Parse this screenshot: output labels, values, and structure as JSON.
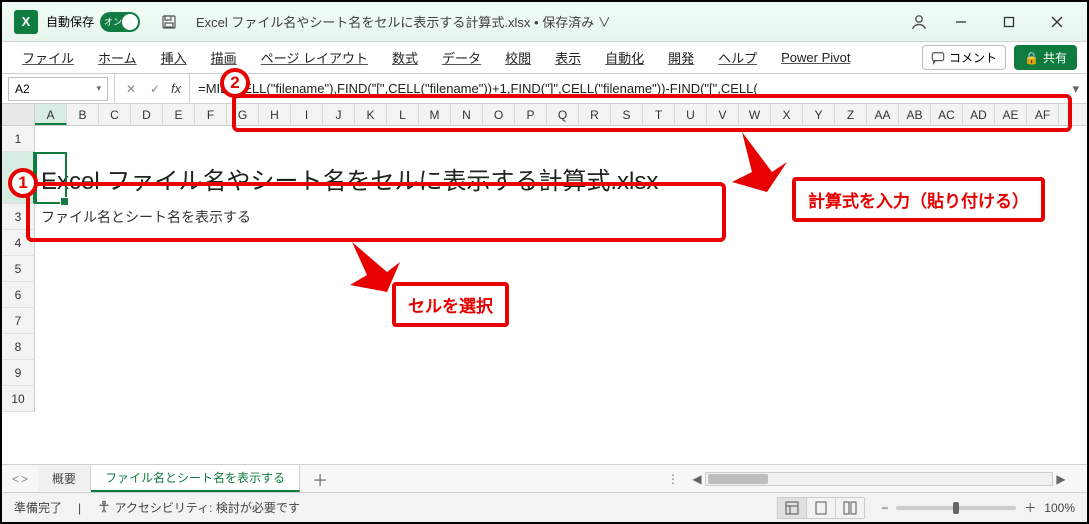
{
  "titlebar": {
    "app_icon_letter": "X",
    "autosave_label": "自動保存",
    "autosave_toggle_text": "オン",
    "doc_title": "Excel ファイル名やシート名をセルに表示する計算式.xlsx • 保存済み ∨"
  },
  "ribbon": {
    "tabs": [
      "ファイル",
      "ホーム",
      "挿入",
      "描画",
      "ページ レイアウト",
      "数式",
      "データ",
      "校閲",
      "表示",
      "自動化",
      "開発",
      "ヘルプ",
      "Power Pivot"
    ],
    "comment_label": "コメント",
    "share_label": "共有"
  },
  "formula": {
    "namebox": "A2",
    "fx_label": "fx",
    "text": "=MID(CELL(\"filename\"),FIND(\"[\",CELL(\"filename\"))+1,FIND(\"]\",CELL(\"filename\"))-FIND(\"[\",CELL("
  },
  "columns": [
    "A",
    "B",
    "C",
    "D",
    "E",
    "F",
    "G",
    "H",
    "I",
    "J",
    "K",
    "L",
    "M",
    "N",
    "O",
    "P",
    "Q",
    "R",
    "S",
    "T",
    "U",
    "V",
    "W",
    "X",
    "Y",
    "Z",
    "AA",
    "AB",
    "AC",
    "AD",
    "AE",
    "AF"
  ],
  "rows": [
    "1",
    "2",
    "3",
    "4",
    "5",
    "6",
    "7",
    "8",
    "9",
    "10"
  ],
  "cells": {
    "a2": "Excel ファイル名やシート名をセルに表示する計算式.xlsx",
    "a4": "ファイル名とシート名を表示する"
  },
  "sheets": {
    "tab1": "概要",
    "tab2": "ファイル名とシート名を表示する"
  },
  "status": {
    "ready": "準備完了",
    "accessibility": "アクセシビリティ: 検討が必要です",
    "zoom": "100%"
  },
  "annotations": {
    "callout1_num": "1",
    "callout2_num": "2",
    "label_formula": "計算式を入力（貼り付ける）",
    "label_cell": "セルを選択"
  },
  "glyphs": {
    "plus": "＋",
    "minus": "−",
    "acct": "◔",
    "min": "—",
    "max": "☐",
    "close": "✕",
    "check": "✓",
    "x": "✕",
    "caret": "▾",
    "left": "◀",
    "right": "▶",
    "dots": "⋮",
    "lock": "🔒"
  }
}
